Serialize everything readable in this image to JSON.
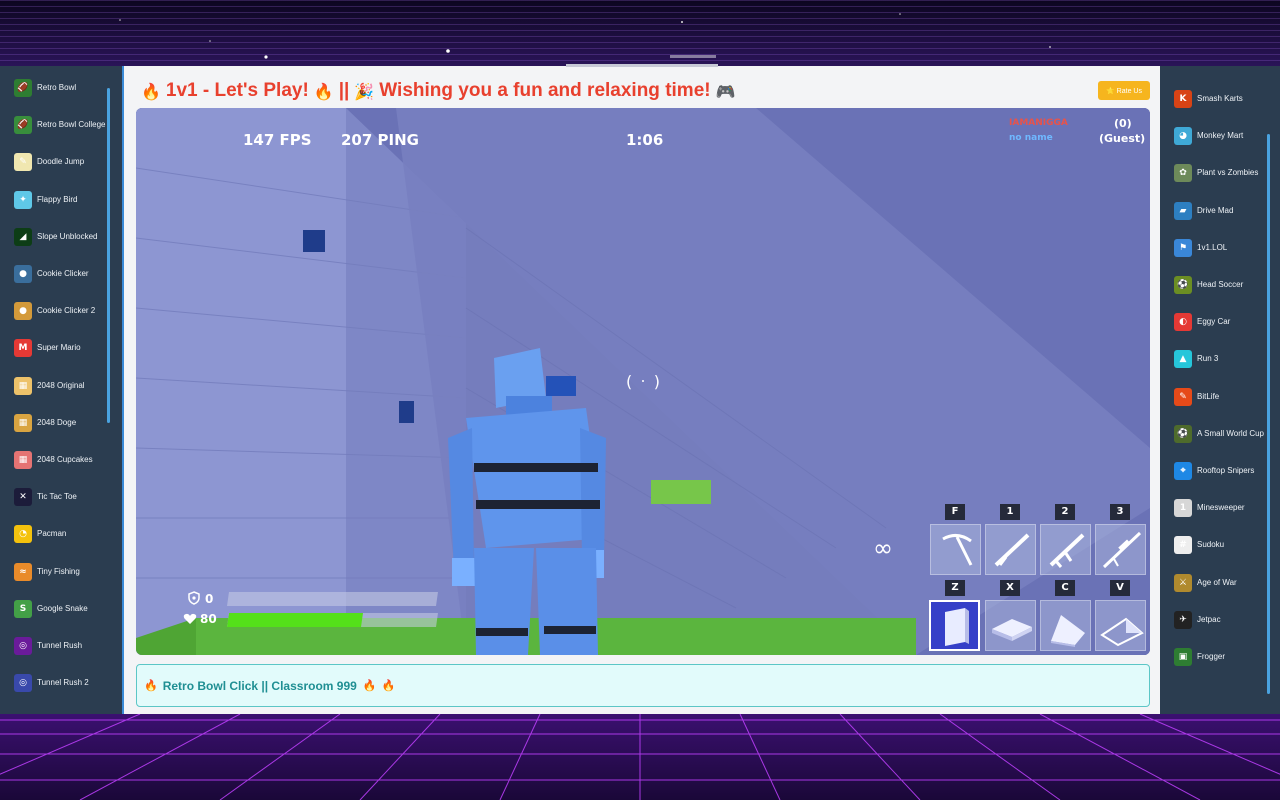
{
  "page": {
    "title_prefix_emoji": "🔥",
    "title_main": "1v1 - Let's Play!",
    "title_mid_emoji": "🔥",
    "title_separator": "||",
    "title_party_emoji": "🎉",
    "title_tagline": "Wishing you a fun and relaxing time!",
    "title_end_emoji": "🎮",
    "rate_button_label": "⭐ Rate Us"
  },
  "left_sidebar": {
    "items": [
      {
        "label": "Retro Bowl",
        "icon": "retro-bowl-icon",
        "color": "#2e7d32",
        "glyph": "🏈"
      },
      {
        "label": "Retro Bowl College",
        "icon": "retro-bowl-college-icon",
        "color": "#388e3c",
        "glyph": "🏈"
      },
      {
        "label": "Doodle Jump",
        "icon": "doodle-jump-icon",
        "color": "#f0e7b0",
        "glyph": "✎"
      },
      {
        "label": "Flappy Bird",
        "icon": "flappy-bird-icon",
        "color": "#5fc8e8",
        "glyph": "✦"
      },
      {
        "label": "Slope Unblocked",
        "icon": "slope-icon",
        "color": "#0d3d16",
        "glyph": "◢"
      },
      {
        "label": "Cookie Clicker",
        "icon": "cookie-clicker-icon",
        "color": "#3a6e9c",
        "glyph": "●"
      },
      {
        "label": "Cookie Clicker 2",
        "icon": "cookie-clicker-2-icon",
        "color": "#d49a3a",
        "glyph": "●"
      },
      {
        "label": "Super Mario",
        "icon": "super-mario-icon",
        "color": "#e53935",
        "glyph": "M"
      },
      {
        "label": "2048 Original",
        "icon": "2048-icon",
        "color": "#edc26a",
        "glyph": "▦"
      },
      {
        "label": "2048 Doge",
        "icon": "2048-doge-icon",
        "color": "#d9a441",
        "glyph": "▦"
      },
      {
        "label": "2048 Cupcakes",
        "icon": "2048-cupcakes-icon",
        "color": "#e57373",
        "glyph": "▦"
      },
      {
        "label": "Tic Tac Toe",
        "icon": "tic-tac-toe-icon",
        "color": "#1c1c3a",
        "glyph": "✕"
      },
      {
        "label": "Pacman",
        "icon": "pacman-icon",
        "color": "#f4c20d",
        "glyph": "◔"
      },
      {
        "label": "Tiny Fishing",
        "icon": "tiny-fishing-icon",
        "color": "#e98b2a",
        "glyph": "≈"
      },
      {
        "label": "Google Snake",
        "icon": "google-snake-icon",
        "color": "#43a047",
        "glyph": "S"
      },
      {
        "label": "Tunnel Rush",
        "icon": "tunnel-rush-icon",
        "color": "#6a1b9a",
        "glyph": "◎"
      },
      {
        "label": "Tunnel Rush 2",
        "icon": "tunnel-rush-2-icon",
        "color": "#3949ab",
        "glyph": "◎"
      }
    ]
  },
  "right_sidebar": {
    "items": [
      {
        "label": "Smash Karts",
        "icon": "smash-karts-icon",
        "color": "#d84315",
        "glyph": "K"
      },
      {
        "label": "Monkey Mart",
        "icon": "monkey-mart-icon",
        "color": "#3fa9d6",
        "glyph": "◕"
      },
      {
        "label": "Plant vs Zombies",
        "icon": "plant-vs-zombies-icon",
        "color": "#6d8a5a",
        "glyph": "✿"
      },
      {
        "label": "Drive Mad",
        "icon": "drive-mad-icon",
        "color": "#2d7fc1",
        "glyph": "▰"
      },
      {
        "label": "1v1.LOL",
        "icon": "1v1-lol-icon",
        "color": "#3a87d8",
        "glyph": "⚑"
      },
      {
        "label": "Head Soccer",
        "icon": "head-soccer-icon",
        "color": "#6b8e23",
        "glyph": "⚽"
      },
      {
        "label": "Eggy Car",
        "icon": "eggy-car-icon",
        "color": "#e53935",
        "glyph": "◐"
      },
      {
        "label": "Run 3",
        "icon": "run-3-icon",
        "color": "#26c6da",
        "glyph": "▲"
      },
      {
        "label": "BitLife",
        "icon": "bitlife-icon",
        "color": "#e64a19",
        "glyph": "✎"
      },
      {
        "label": "A Small World Cup",
        "icon": "small-world-cup-icon",
        "color": "#4e6b2c",
        "glyph": "⚽"
      },
      {
        "label": "Rooftop Snipers",
        "icon": "rooftop-snipers-icon",
        "color": "#1e88e5",
        "glyph": "⌖"
      },
      {
        "label": "Minesweeper",
        "icon": "minesweeper-icon",
        "color": "#d7d7d7",
        "glyph": "1"
      },
      {
        "label": "Sudoku",
        "icon": "sudoku-icon",
        "color": "#eeeeee",
        "glyph": "#"
      },
      {
        "label": "Age of War",
        "icon": "age-of-war-icon",
        "color": "#b08a2e",
        "glyph": "⚔"
      },
      {
        "label": "Jetpac",
        "icon": "jetpac-icon",
        "color": "#222222",
        "glyph": "✈"
      },
      {
        "label": "Frogger",
        "icon": "frogger-icon",
        "color": "#2e7d32",
        "glyph": "▣"
      }
    ]
  },
  "game_hud": {
    "fps": "147 FPS",
    "ping": "207 PING",
    "timer": "1:06",
    "player_name": "IAMANIGGA",
    "player_sub": "no name",
    "score": "(0)",
    "score_label": "(Guest)",
    "ammo": "∞",
    "shield": "0",
    "health": "80",
    "health_fraction": 0.8,
    "weapon_hotkeys": [
      "F",
      "1",
      "2",
      "3"
    ],
    "build_hotkeys": [
      "Z",
      "X",
      "C",
      "V"
    ],
    "selected_slot": "Z",
    "colors": {
      "health": "#54e01a",
      "selected_slot": "#3540c8",
      "player_name": "#e8534a",
      "player_sub": "#6fb8ff"
    }
  },
  "info_bar": {
    "prefix_emoji": "🔥",
    "text": "Retro Bowl Click || Classroom 999",
    "suffix_emoji_1": "🔥",
    "suffix_emoji_2": "🔥"
  }
}
